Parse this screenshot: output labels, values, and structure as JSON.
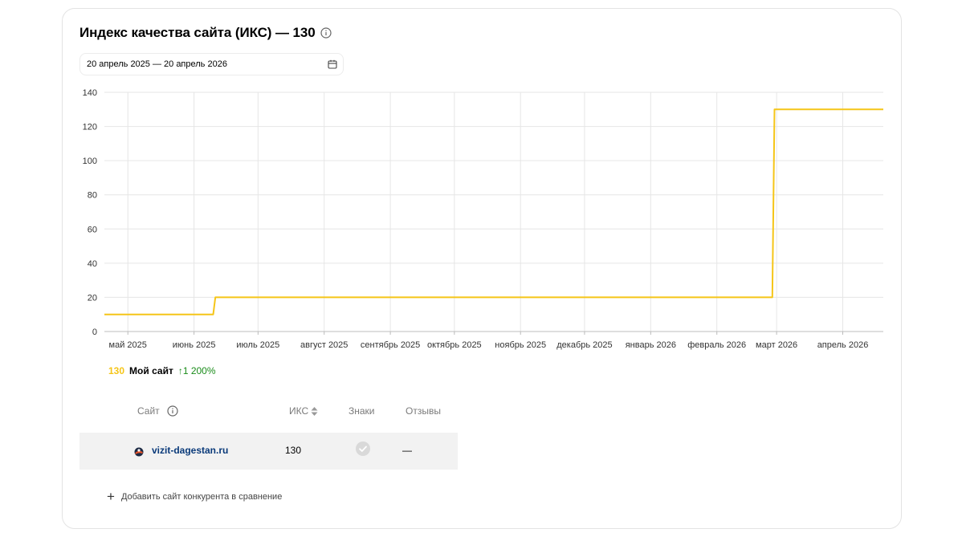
{
  "widget": {
    "title": "Индекс качества сайта (ИКС) — 130",
    "date_range": "20 апрель 2025 — 20 апрель 2026"
  },
  "colors": {
    "series": "#f5c518",
    "grid": "#e6e6e6",
    "growth": "#1a8c1a",
    "link": "#0a3a7a",
    "row_bg": "#f2f2f2"
  },
  "icons": [
    "info-icon",
    "calendar-icon",
    "sort-icon",
    "check-circle-icon",
    "favicon",
    "plus-icon"
  ],
  "chart_data": {
    "type": "line",
    "title": "",
    "xlabel": "",
    "ylabel": "",
    "ylim": [
      0,
      140
    ],
    "yticks": [
      0,
      20,
      40,
      60,
      80,
      100,
      120,
      140
    ],
    "xlim": [
      "2025-04-20",
      "2026-04-20"
    ],
    "xticks": [
      {
        "date": "2025-05-01",
        "label": "май 2025"
      },
      {
        "date": "2025-06-01",
        "label": "июнь 2025"
      },
      {
        "date": "2025-07-01",
        "label": "июль 2025"
      },
      {
        "date": "2025-08-01",
        "label": "август 2025"
      },
      {
        "date": "2025-09-01",
        "label": "сентябрь 2025"
      },
      {
        "date": "2025-10-01",
        "label": "октябрь 2025"
      },
      {
        "date": "2025-11-01",
        "label": "ноябрь 2025"
      },
      {
        "date": "2025-12-01",
        "label": "декабрь 2025"
      },
      {
        "date": "2026-01-01",
        "label": "январь 2026"
      },
      {
        "date": "2026-02-01",
        "label": "февраль 2026"
      },
      {
        "date": "2026-03-01",
        "label": "март 2026"
      },
      {
        "date": "2026-04-01",
        "label": "апрель 2026"
      }
    ],
    "grid": true,
    "series": [
      {
        "step": true,
        "points": [
          {
            "x": "2025-04-20",
            "y": 10
          },
          {
            "x": "2025-06-10",
            "y": 10
          },
          {
            "x": "2025-06-11",
            "y": 20
          },
          {
            "x": "2026-02-27",
            "y": 20
          },
          {
            "x": "2026-02-28",
            "y": 130
          },
          {
            "x": "2026-04-20",
            "y": 130
          }
        ]
      }
    ]
  },
  "legend": {
    "value": "130",
    "name": "Мой сайт",
    "change": "↑1 200%"
  },
  "table": {
    "columns": [
      "Сайт",
      "ИКС",
      "Знаки",
      "Отзывы"
    ],
    "rows": [
      {
        "site": "vizit-dagestan.ru",
        "iks": "130",
        "signs": "check",
        "reviews": "—"
      }
    ]
  },
  "add_competitor_label": "Добавить сайт конкурента в сравнение"
}
